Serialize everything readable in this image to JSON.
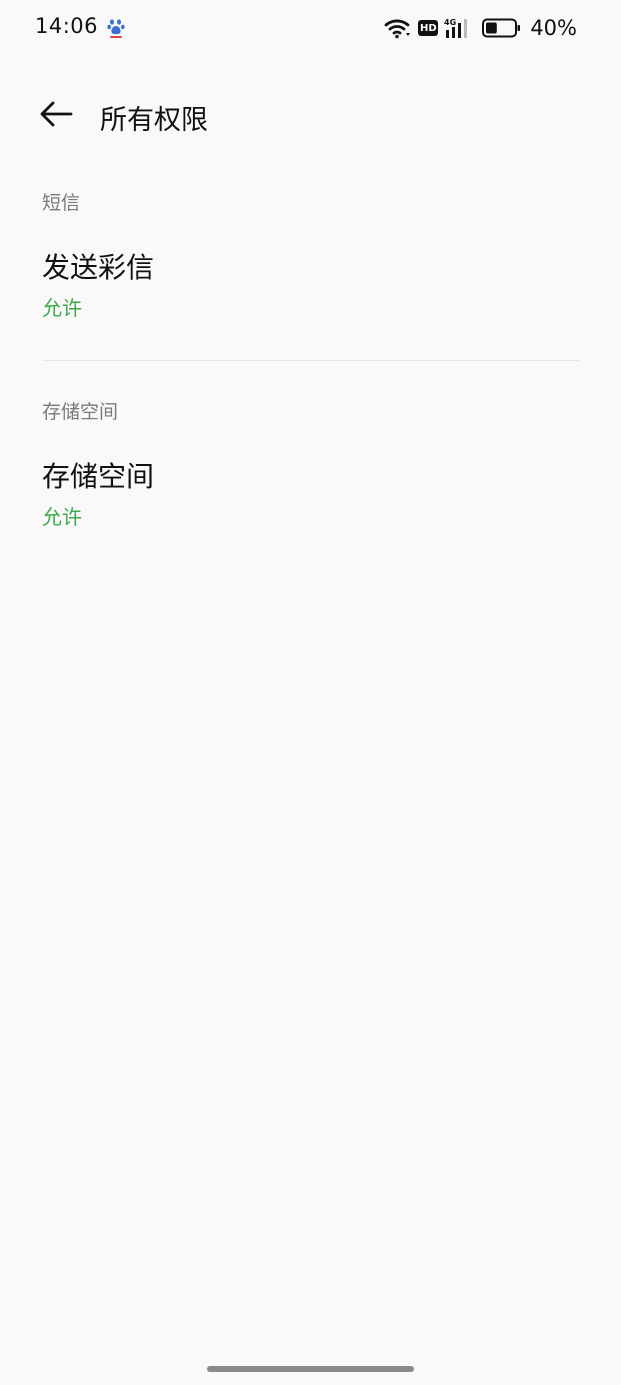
{
  "status_bar": {
    "time": "14:06",
    "app_icon": "baidu-paw-icon",
    "hd_label": "HD",
    "network_label": "4G",
    "battery_percent": "40%",
    "battery_level": 0.4
  },
  "header": {
    "back_icon": "back-arrow-icon",
    "title": "所有权限"
  },
  "sections": [
    {
      "header": "短信",
      "items": [
        {
          "title": "发送彩信",
          "status": "允许"
        }
      ]
    },
    {
      "header": "存储空间",
      "items": [
        {
          "title": "存储空间",
          "status": "允许"
        }
      ]
    }
  ],
  "colors": {
    "allowed_green": "#3ea84a",
    "section_grey": "#7a7a7a",
    "background": "#f9f9f9"
  }
}
